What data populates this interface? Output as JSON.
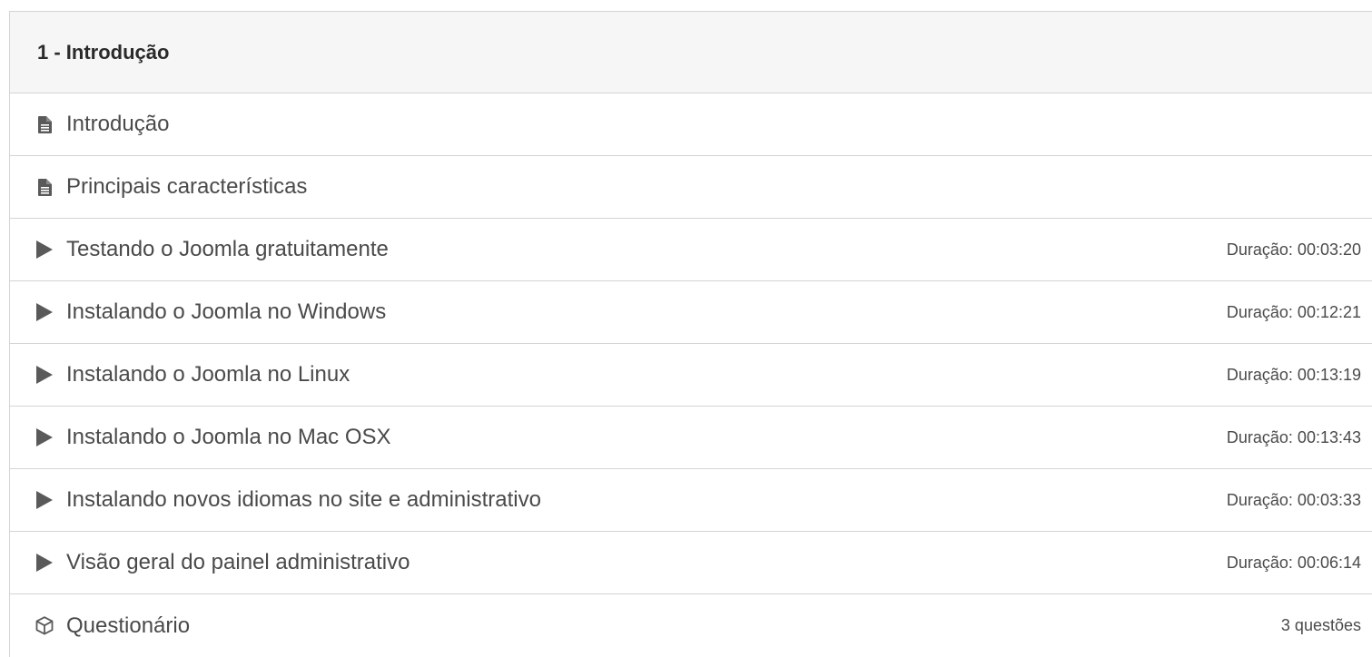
{
  "module": {
    "title": "1 - Introdução"
  },
  "lessons": [
    {
      "type": "document",
      "icon": "document-icon",
      "title": "Introdução",
      "meta": ""
    },
    {
      "type": "document",
      "icon": "document-icon",
      "title": "Principais características",
      "meta": ""
    },
    {
      "type": "video",
      "icon": "play-icon",
      "title": "Testando o Joomla gratuitamente",
      "meta": "Duração: 00:03:20"
    },
    {
      "type": "video",
      "icon": "play-icon",
      "title": "Instalando o Joomla no Windows",
      "meta": "Duração: 00:12:21"
    },
    {
      "type": "video",
      "icon": "play-icon",
      "title": "Instalando o Joomla no Linux",
      "meta": "Duração: 00:13:19"
    },
    {
      "type": "video",
      "icon": "play-icon",
      "title": "Instalando o Joomla no Mac OSX",
      "meta": "Duração: 00:13:43"
    },
    {
      "type": "video",
      "icon": "play-icon",
      "title": "Instalando novos idiomas no site e administrativo",
      "meta": "Duração: 00:03:33"
    },
    {
      "type": "video",
      "icon": "play-icon",
      "title": "Visão geral do painel administrativo",
      "meta": "Duração: 00:06:14"
    },
    {
      "type": "quiz",
      "icon": "cube-icon",
      "title": "Questionário",
      "meta": "3 questões"
    }
  ],
  "colors": {
    "text": "#4a4a4a",
    "icon": "#5a5a5a",
    "border": "#d4d4d4",
    "header_bg": "#f6f6f6"
  }
}
